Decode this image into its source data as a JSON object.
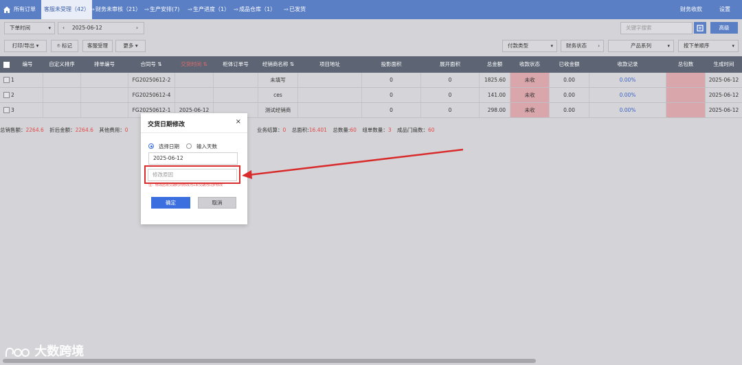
{
  "nav": {
    "tabs": [
      {
        "label": "所有订单"
      },
      {
        "label": "客服未受理（42）"
      },
      {
        "label": "财务未审核（21）"
      },
      {
        "label": "生产安排(7)"
      },
      {
        "label": "生产进度（1）"
      },
      {
        "label": "成品仓库（1）"
      },
      {
        "label": "已发货"
      }
    ],
    "right": [
      "财务收款",
      "设置"
    ],
    "arrow": "-->"
  },
  "toolbar": {
    "time_filter": "下单时间",
    "date": "2025-06-12",
    "search_placeholder": "关键字搜索",
    "advanced": "高级",
    "print_export": "打印/导出",
    "mark": "标记",
    "accept": "客服受理",
    "more": "更多",
    "pay_type": "付款类型",
    "finance_status": "财务状态",
    "product_series": "产品系列",
    "sort": "按下单顺序"
  },
  "table": {
    "headers": [
      "编号",
      "自定义排序",
      "排单编号",
      "合同号",
      "交货时间",
      "柜体订单号",
      "经销商名称",
      "项目地址",
      "投影面积",
      "展开面积",
      "总金额",
      "收款状态",
      "已收金额",
      "收款记录",
      "总包数",
      "生成时间"
    ],
    "rows": [
      {
        "no": "1",
        "contract": "FG20250612-2",
        "delivery": "",
        "dealer": "未填写",
        "proj_area": "0",
        "exp_area": "0",
        "total": "1825.60",
        "status": "未收",
        "received": "0.00",
        "record": "0.00%",
        "created": "2025-06-12"
      },
      {
        "no": "2",
        "contract": "FG20250612-4",
        "delivery": "",
        "dealer": "ces",
        "proj_area": "0",
        "exp_area": "0",
        "total": "141.00",
        "status": "未收",
        "received": "0.00",
        "record": "0.00%",
        "created": "2025-06-12"
      },
      {
        "no": "3",
        "contract": "FG20250612-1",
        "delivery": "2025-06-12",
        "dealer": "测试经销商",
        "proj_area": "0",
        "exp_area": "0",
        "total": "298.00",
        "status": "未收",
        "received": "0.00",
        "record": "0.00%",
        "created": "2025-06-12"
      }
    ]
  },
  "summary": {
    "total_sales_label": "总销售额：",
    "total_sales": "2264.6",
    "discount_label": "折后金额：",
    "discount": "2264.6",
    "other_label": "其他费用：",
    "other": "0",
    "business_label": "业务结算：",
    "business": "0",
    "area_label": "总面积:",
    "area": "16.401",
    "qty_label": "总数量:",
    "qty": "60",
    "set_label": "组单数量：",
    "set": "3",
    "doors_label": "成品门扇数：",
    "doors": "60"
  },
  "modal": {
    "title": "交货日期修改",
    "close": "×",
    "opt_date": "选择日期",
    "opt_days": "输入天数",
    "date_value": "2025-06-12",
    "reason_placeholder": "修改原因",
    "hint": "注：修改后将交期时间修改为1单交期为同步修改",
    "confirm": "确定",
    "cancel": "取消"
  },
  "watermark": "大数跨境",
  "colors": {
    "nav": "#5b7fc5",
    "header": "#5d6574",
    "primary": "#3b6fe0",
    "warn": "#e04848",
    "annotation": "#d92b2b"
  }
}
